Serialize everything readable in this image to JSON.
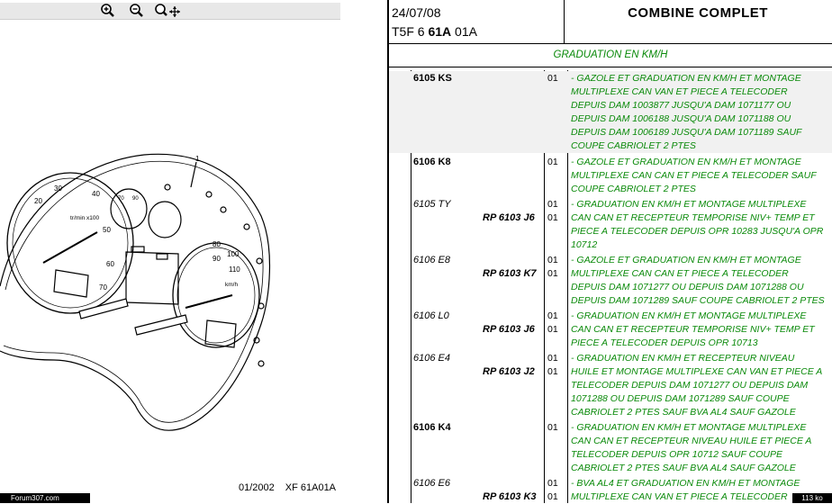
{
  "toolbar": {
    "zoom_in": "zoom-in-icon",
    "zoom_out": "zoom-out-icon",
    "zoom_pan": "zoom-pan-icon"
  },
  "drawing": {
    "callout": "1",
    "speedo_ticks": [
      "20",
      "30",
      "40",
      "50",
      "60",
      "70"
    ],
    "speedo_unit": "tr/min x100",
    "speed_ticks": [
      "80",
      "90",
      "100",
      "110"
    ],
    "speed_unit": "km/h",
    "small_gauge_ticks": [
      "70",
      "90"
    ]
  },
  "plate": {
    "date": "01/2002",
    "code": "XF 61A01A"
  },
  "watermark": "Forum307.com",
  "header": {
    "date": "24/07/08",
    "ref_prefix": "T5F 6 ",
    "ref_bold": "61A",
    "ref_suffix": " 01A",
    "title": "COMBINE COMPLET"
  },
  "section_title": "GRADUATION EN KM/H",
  "rows": [
    {
      "part": "6105 KS",
      "italic": false,
      "rp": "",
      "idx": [
        "01"
      ],
      "desc": [
        "- GAZOLE ET GRADUATION EN KM/H ET MONTAGE",
        "MULTIPLEXE CAN VAN ET PIECE A TELECODER",
        "DEPUIS DAM 1003877 JUSQU'A DAM 1071177 OU",
        "DEPUIS DAM 1006188 JUSQU'A DAM 1071188 OU",
        "DEPUIS DAM 1006189 JUSQU'A DAM 1071189 SAUF",
        "COUPE CABRIOLET 2 PTES"
      ]
    },
    {
      "part": "6106 K8",
      "italic": false,
      "rp": "",
      "idx": [
        "01"
      ],
      "desc": [
        "- GAZOLE ET GRADUATION EN KM/H ET MONTAGE",
        "MULTIPLEXE CAN CAN ET PIECE A TELECODER SAUF",
        "COUPE CABRIOLET 2 PTES"
      ]
    },
    {
      "part": "6105 TY",
      "italic": true,
      "rp": "RP 6103 J6",
      "idx": [
        "01",
        "01"
      ],
      "desc": [
        "- GRADUATION EN KM/H ET MONTAGE MULTIPLEXE",
        "CAN CAN ET RECEPTEUR TEMPORISE NIV+ TEMP ET",
        "PIECE A TELECODER DEPUIS OPR 10283 JUSQU'A OPR",
        "10712"
      ]
    },
    {
      "part": "6106 E8",
      "italic": true,
      "rp": "RP 6103 K7",
      "idx": [
        "01",
        "01"
      ],
      "desc": [
        "- GAZOLE ET GRADUATION EN KM/H ET MONTAGE",
        "MULTIPLEXE CAN CAN ET PIECE A TELECODER",
        "DEPUIS DAM 1071277 OU DEPUIS DAM 1071288 OU",
        "DEPUIS DAM 1071289 SAUF COUPE CABRIOLET 2 PTES"
      ]
    },
    {
      "part": "6106 L0",
      "italic": true,
      "rp": "RP 6103 J6",
      "idx": [
        "01",
        "01"
      ],
      "desc": [
        "- GRADUATION EN KM/H ET MONTAGE MULTIPLEXE",
        "CAN CAN ET RECEPTEUR TEMPORISE NIV+ TEMP ET",
        "PIECE A TELECODER DEPUIS OPR 10713"
      ]
    },
    {
      "part": "6106 E4",
      "italic": true,
      "rp": "RP 6103 J2",
      "idx": [
        "01",
        "01"
      ],
      "desc": [
        "- GRADUATION EN KM/H ET RECEPTEUR NIVEAU",
        "HUILE ET MONTAGE MULTIPLEXE CAN VAN ET PIECE A",
        "TELECODER DEPUIS DAM 1071277 OU DEPUIS DAM",
        "1071288 OU DEPUIS DAM 1071289 SAUF COUPE",
        "CABRIOLET 2 PTES SAUF BVA AL4 SAUF GAZOLE"
      ]
    },
    {
      "part": "6106 K4",
      "italic": false,
      "rp": "",
      "idx": [
        "01"
      ],
      "desc": [
        "- GRADUATION EN KM/H ET MONTAGE MULTIPLEXE",
        "CAN CAN ET RECEPTEUR NIVEAU HUILE ET PIECE A",
        "TELECODER DEPUIS OPR 10712 SAUF COUPE",
        "CABRIOLET 2 PTES SAUF BVA AL4 SAUF GAZOLE"
      ]
    },
    {
      "part": "6106 E6",
      "italic": true,
      "rp": "RP 6103 K3",
      "idx": [
        "01",
        "01"
      ],
      "desc": [
        "- BVA AL4 ET GRADUATION EN KM/H ET MONTAGE",
        "MULTIPLEXE CAN VAN ET PIECE A TELECODER"
      ]
    }
  ],
  "size_badge": "113 ko"
}
